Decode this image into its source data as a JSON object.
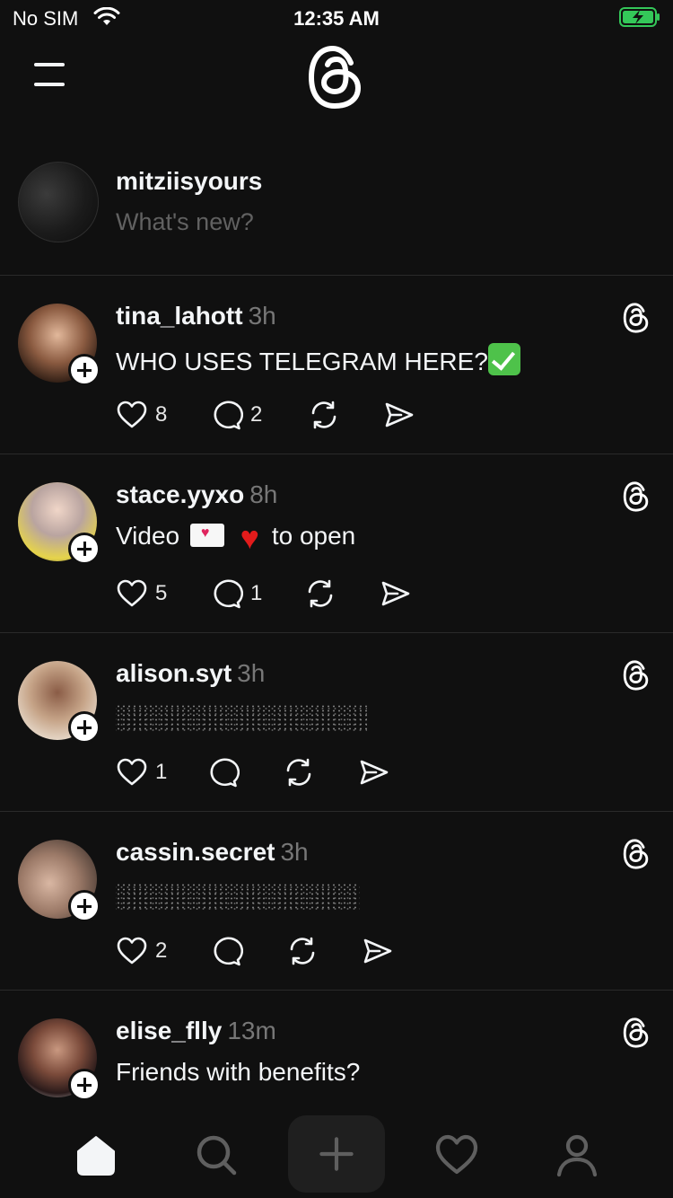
{
  "status": {
    "carrier": "No SIM",
    "time": "12:35 AM",
    "battery_color": "#34c759"
  },
  "header": {
    "logo_icon": "threads-logo-icon",
    "menu_icon": "hamburger-menu-icon"
  },
  "compose": {
    "username": "mitziisyours",
    "placeholder": "What's new?"
  },
  "posts": [
    {
      "username": "tina_lahott",
      "time": "3h",
      "text": "WHO USES TELEGRAM HERE?",
      "emoji": "check-mark",
      "likes": "8",
      "replies": "2",
      "avatar_color": "#c9a081"
    },
    {
      "username": "stace.yyxo",
      "time": "8h",
      "text_before": "Video",
      "text_after": "to open",
      "likes": "5",
      "replies": "1",
      "avatar_color": "#d9c1b3"
    },
    {
      "username": "alison.syt",
      "time": "3h",
      "likes": "1",
      "replies": "",
      "avatar_color": "#c8a58c"
    },
    {
      "username": "cassin.secret",
      "time": "3h",
      "likes": "2",
      "replies": "",
      "avatar_color": "#b58f7d"
    },
    {
      "username": "elise_flly",
      "time": "13m",
      "text": "Friends with benefits?",
      "avatar_color": "#6f4536"
    }
  ],
  "tabbar": {
    "items": [
      "home-icon",
      "search-icon",
      "compose-icon",
      "activity-heart-icon",
      "profile-icon"
    ]
  }
}
